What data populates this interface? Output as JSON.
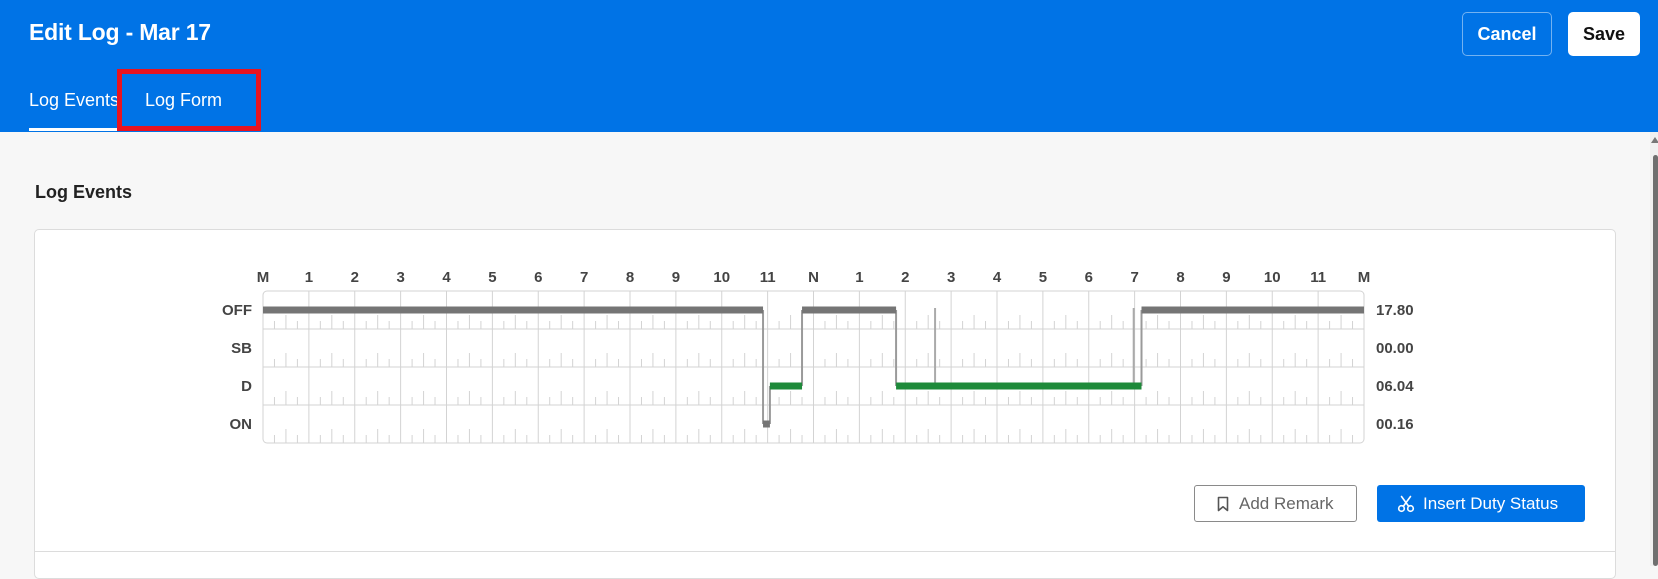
{
  "header": {
    "title": "Edit Log - Mar 17",
    "cancel_label": "Cancel",
    "save_label": "Save",
    "tabs": [
      {
        "label": "Log Events",
        "active": true
      },
      {
        "label": "Log Form",
        "active": false
      }
    ]
  },
  "section": {
    "title": "Log Events"
  },
  "log_chart": {
    "hour_labels": [
      "M",
      "1",
      "2",
      "3",
      "4",
      "5",
      "6",
      "7",
      "8",
      "9",
      "10",
      "11",
      "N",
      "1",
      "2",
      "3",
      "4",
      "5",
      "6",
      "7",
      "8",
      "9",
      "10",
      "11",
      "M"
    ],
    "rows": [
      {
        "label": "OFF",
        "total": "17.80"
      },
      {
        "label": "SB",
        "total": "00.00"
      },
      {
        "label": "D",
        "total": "06.04"
      },
      {
        "label": "ON",
        "total": "00.16"
      }
    ],
    "segments": [
      {
        "status": "OFF",
        "start": 0,
        "end": 10.9
      },
      {
        "status": "ON",
        "start": 10.9,
        "end": 11.05
      },
      {
        "status": "D",
        "start": 11.05,
        "end": 11.75
      },
      {
        "status": "OFF",
        "start": 11.75,
        "end": 13.8
      },
      {
        "status": "D",
        "start": 13.8,
        "end": 19.15
      },
      {
        "status": "OFF",
        "start": 19.15,
        "end": 24
      }
    ],
    "marker_hours": [
      14.65,
      18.98
    ],
    "colors": {
      "off": "#757575",
      "driving": "#1e8a3a",
      "grid": "#d3d3d3"
    }
  },
  "actions": {
    "add_remark_label": "Add Remark",
    "insert_duty_label": "Insert Duty Status",
    "add_remark_icon": "bookmark-icon",
    "insert_duty_icon": "scissors-icon"
  },
  "theme": {
    "primary": "#0073e6",
    "highlight": "#e8131f"
  }
}
